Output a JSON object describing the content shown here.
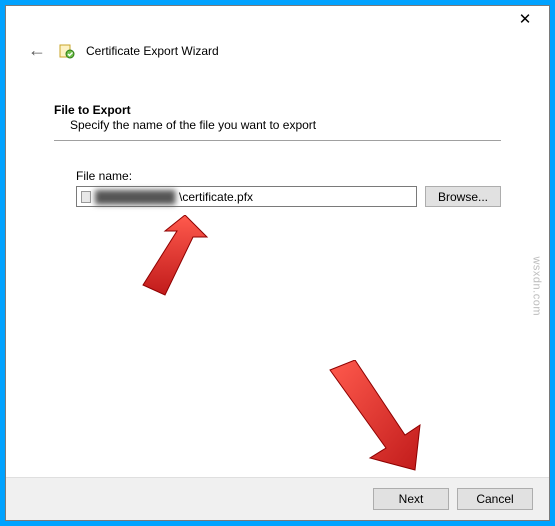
{
  "titlebar": {
    "close_glyph": "✕"
  },
  "header": {
    "back_glyph": "←",
    "title": "Certificate Export Wizard"
  },
  "section": {
    "title": "File to Export",
    "subtitle": "Specify the name of the file you want to export"
  },
  "file": {
    "label": "File name:",
    "path_hidden": "██████████",
    "path_visible": "\\certificate.pfx",
    "browse_label": "Browse..."
  },
  "footer": {
    "next_label": "Next",
    "cancel_label": "Cancel"
  },
  "watermark": "wsxdn.com"
}
